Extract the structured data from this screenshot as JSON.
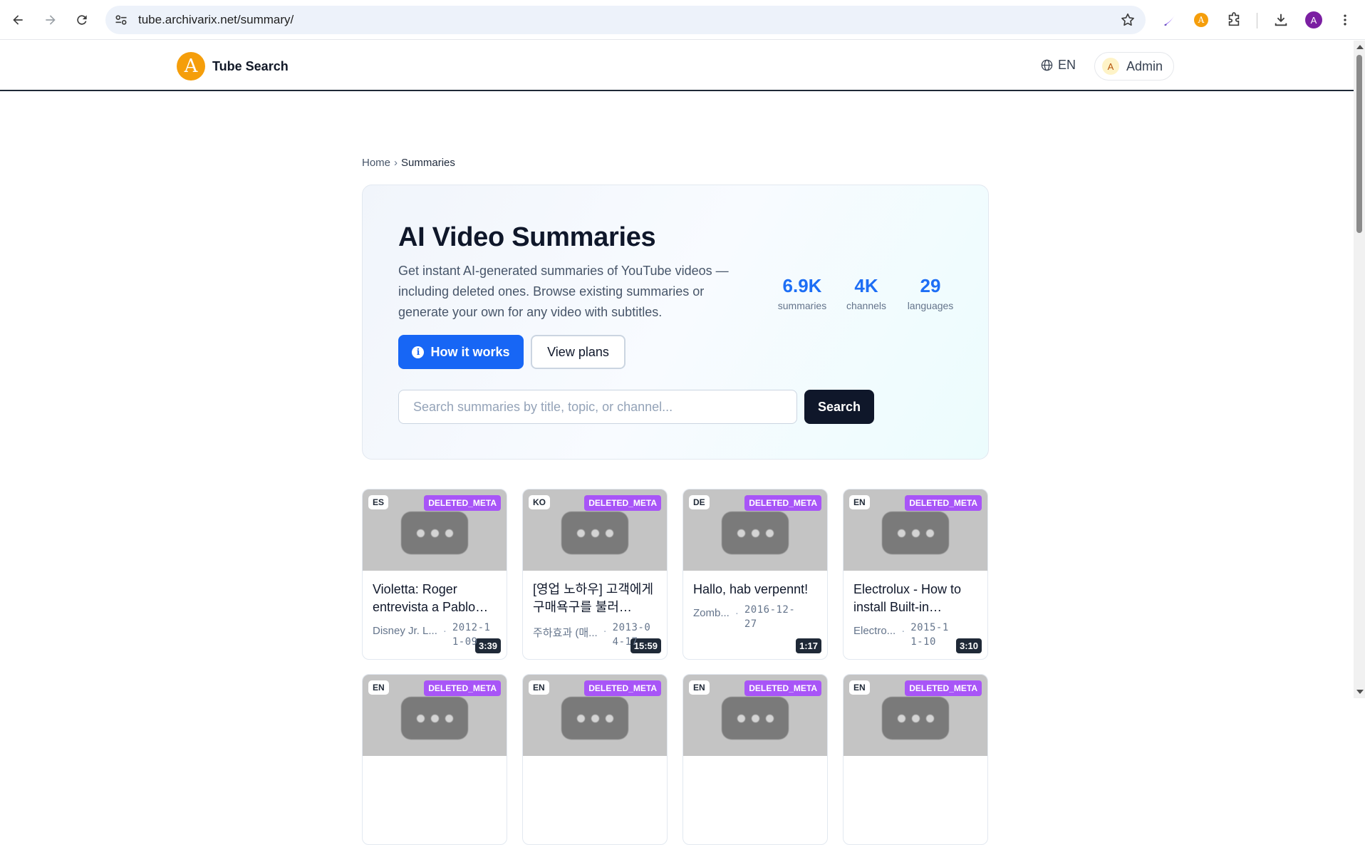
{
  "browser": {
    "url": "tube.archivarix.net/summary/",
    "profile_initial": "A",
    "extension_initial": "A"
  },
  "header": {
    "brand": "Tube Search",
    "logo_letter": "A",
    "language": "EN",
    "user_initial": "A",
    "user_name": "Admin"
  },
  "breadcrumb": {
    "home": "Home",
    "separator": "›",
    "current": "Summaries"
  },
  "hero": {
    "title": "AI Video Summaries",
    "description": "Get instant AI-generated summaries of YouTube videos — including deleted ones. Browse existing summaries or generate your own for any video with subtitles.",
    "stats": [
      {
        "value": "6.9K",
        "label": "summaries"
      },
      {
        "value": "4K",
        "label": "channels"
      },
      {
        "value": "29",
        "label": "languages"
      }
    ],
    "how_it_works": "How it works",
    "view_plans": "View plans",
    "search_placeholder": "Search summaries by title, topic, or channel...",
    "search_button": "Search"
  },
  "cards": [
    {
      "lang": "ES",
      "tag": "DELETED_META",
      "duration": "3:39",
      "title": "Violetta: Roger entrevista a Pablo…",
      "channel": "Disney Jr. L...",
      "date": "2012-11-09"
    },
    {
      "lang": "KO",
      "tag": "DELETED_META",
      "duration": "15:59",
      "title": "[영업 노하우] 고객에게 구매욕구를 불러…",
      "channel": "주하효과 (매...",
      "date": "2013-04-17"
    },
    {
      "lang": "DE",
      "tag": "DELETED_META",
      "duration": "1:17",
      "title": "Hallo, hab verpennt!",
      "channel": "Zomb...",
      "date": "2016-12-27"
    },
    {
      "lang": "EN",
      "tag": "DELETED_META",
      "duration": "3:10",
      "title": "Electrolux - How to install Built-in…",
      "channel": "Electro...",
      "date": "2015-11-10"
    },
    {
      "lang": "EN",
      "tag": "DELETED_META"
    },
    {
      "lang": "EN",
      "tag": "DELETED_META"
    },
    {
      "lang": "EN",
      "tag": "DELETED_META"
    },
    {
      "lang": "EN",
      "tag": "DELETED_META"
    }
  ],
  "colors": {
    "primary": "#1766f5",
    "stat_number": "#1d6ef5",
    "deleted_badge": "#a855f7",
    "dark_button": "#0f172a",
    "logo": "#f59e0b"
  }
}
